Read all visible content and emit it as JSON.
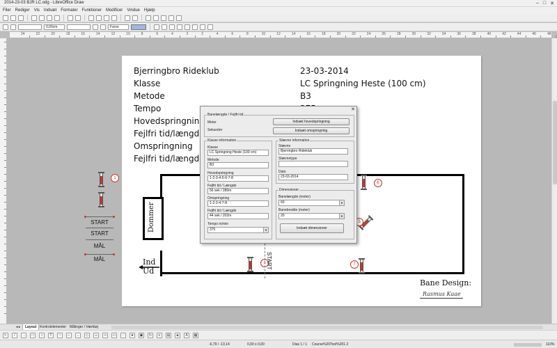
{
  "window": {
    "title": "2014-23-03 BJR LC.odg - LibreOffice Draw",
    "btn_min": "–",
    "btn_max": "□",
    "btn_close": "✕"
  },
  "menu": [
    "Filer",
    "Rediger",
    "Vis",
    "Indsæt",
    "Formater",
    "Funktioner",
    "Modificer",
    "Vindue",
    "Hjælp"
  ],
  "toolbar2": {
    "line_width": "0,00cm",
    "area_style": "Farve"
  },
  "ruler": [
    "24",
    "22",
    "20",
    "18",
    "16",
    "14",
    "12",
    "10",
    "8",
    "6",
    "4",
    "2",
    "2",
    "4",
    "6",
    "8",
    "10",
    "12",
    "14",
    "16",
    "18",
    "20",
    "22",
    "24",
    "26",
    "28",
    "30",
    "32",
    "34",
    "36",
    "38",
    "40",
    "42",
    "44",
    "46",
    "48"
  ],
  "info": [
    {
      "label": "Bjerringbro Rideklub",
      "value": "23-03-2014"
    },
    {
      "label": "Klasse",
      "value": "LC Springning Heste (100 cm)"
    },
    {
      "label": "Metode",
      "value": "B3"
    },
    {
      "label": "Tempo",
      "value": "375"
    },
    {
      "label": "Hovedspringning",
      "value": ""
    },
    {
      "label": "Fejlfri tid/længde",
      "value": ""
    },
    {
      "label": "Omspringning",
      "value": ""
    },
    {
      "label": "Fejlfri tid/længde",
      "value": ""
    }
  ],
  "course": {
    "judge": "Dommer",
    "ind": "Ind",
    "ud": "Ud",
    "start": "START",
    "numbers": [
      "1",
      "6",
      "7",
      "1",
      "3"
    ],
    "designer_label": "Bane Design:",
    "signature": "Rasmus Kaae"
  },
  "legend": {
    "number": "1",
    "start1": "START",
    "start2": "START",
    "maal1": "MÅL",
    "maal2": "MÅL"
  },
  "dialog": {
    "group_top": "Banelængde / Fejlfri tid",
    "meter": "Meter",
    "sekunder": "Sekunder",
    "btn_hoved": "Indsæt hovedspringning",
    "btn_om": "Indsæt omspringning",
    "klasse_group": "Klasse information",
    "klasse_lbl": "Klasse",
    "klasse_val": "LC Springning Heste (100 cm)",
    "metode_lbl": "Metode",
    "metode_val": "B3",
    "hoved_lbl": "Hovedspringning",
    "hoved_val": "1-2-3-4-5-6-7-8",
    "fejl1_lbl": "Fejlfri tid / Længde",
    "fejl1_val": "56 sek / 280m",
    "om_lbl": "Omspringning",
    "om_val": "1-2-3-4-7-8",
    "fejl2_lbl": "Fejlfri tid / Længde",
    "fejl2_val": "44 sek / 202m",
    "tempo_lbl": "Tempo m/min",
    "tempo_val": "375",
    "staevne_group": "Stævne information",
    "staevne_lbl": "Stævne",
    "staevne_val": "Bjerringbro Rideklub",
    "staevnetype_lbl": "Stævnetype",
    "staevnetype_val": "",
    "dato_lbl": "Dato",
    "dato_val": "23-03-2014",
    "dim_group": "Dimensioner",
    "banel_lbl": "Banelængde (meter)",
    "banel_val": "60",
    "baneb_lbl": "Banebredde (meter)",
    "baneb_val": "20",
    "btn_dim": "Indsæt dimensioner",
    "close": "✕"
  },
  "tabs": [
    "Layout",
    "Kontrolelementer",
    "Målinger / Værktøj"
  ],
  "status": {
    "pos": "-6,79 / -13,14",
    "size": "0,00 x 0,00",
    "slide": "Dias 1 / 1",
    "master": "Course%20Tool%201.2",
    "zoom": "110%"
  }
}
